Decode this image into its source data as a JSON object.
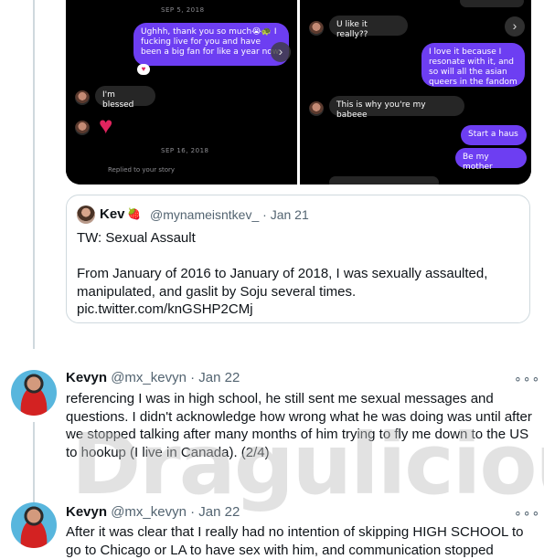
{
  "media": {
    "left_panel": {
      "date1": "SEP 5, 2018",
      "msg1": "Ughhh, thank you so much😭🐢 I fucking live for you and have been a big fan for like a year now.",
      "msg2": "I'm blessed",
      "date2": "SEP 16, 2018",
      "replied": "Replied to your story"
    },
    "right_panel": {
      "msg1": "U like it really??",
      "msg2": "I love it because I resonate with it, and so will all the asian queers in the fandom",
      "msg3": "This is why you're my babeee",
      "msg4": "Start a haus",
      "msg5": "Be my mother"
    }
  },
  "quote": {
    "name": "Kev",
    "emoji": "🍓",
    "handle_time": "@mynameisntkev_ · Jan 21",
    "line1": "TW: Sexual Assault",
    "line2": "From January of 2016 to January of 2018, I was sexually assaulted, manipulated, and gaslit by Soju several times.",
    "line3": "pic.twitter.com/knGSHP2CMj"
  },
  "tweets": [
    {
      "name": "Kevyn",
      "meta": "@mx_kevyn · Jan 22",
      "text": "referencing I was in high school, he still sent me sexual messages and questions. I didn't acknowledge how wrong what he was doing was until after we stopped talking after many months of him trying to fly me down to the US to hookup (I live in Canada). (2/4)"
    },
    {
      "name": "Kevyn",
      "meta": "@mx_kevyn · Jan 22",
      "text": "After it was clear that I really had no intention of skipping HIGH SCHOOL to go to Chicago or LA to have sex with him, and communication stopped"
    }
  ],
  "more_glyph": "∘∘∘",
  "arrow_glyph": "›",
  "heart_glyph": "♥",
  "watermark": "Dragulicious"
}
